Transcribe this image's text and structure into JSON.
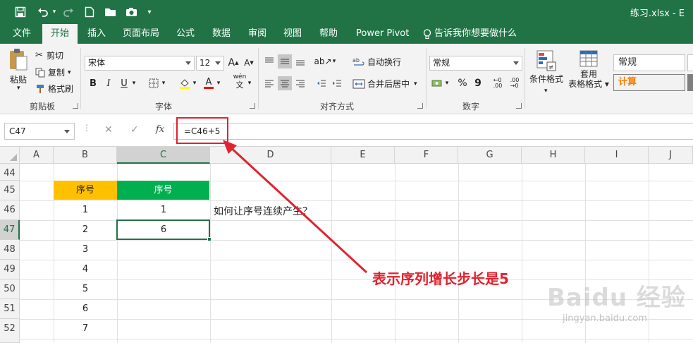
{
  "title_bar": {
    "filename": "练习.xlsx  -  E",
    "icons": [
      "save-icon",
      "undo-icon",
      "redo-icon",
      "new-file-icon",
      "open-folder-icon",
      "camera-icon",
      "customize-qat-icon"
    ]
  },
  "tabs": [
    "文件",
    "开始",
    "插入",
    "页面布局",
    "公式",
    "数据",
    "审阅",
    "视图",
    "帮助",
    "Power Pivot",
    "告诉我你想要做什么"
  ],
  "ribbon": {
    "clipboard": {
      "paste": "粘贴",
      "cut": "剪切",
      "copy": "复制",
      "format_painter": "格式刷",
      "label": "剪贴板"
    },
    "font": {
      "font_name": "宋体",
      "font_size": "12",
      "grow": "A",
      "shrink": "A",
      "bold": "B",
      "italic": "I",
      "underline": "U",
      "font_color_letter": "A",
      "phonetic": "wén",
      "label": "字体",
      "fill_color": "#ffff00",
      "text_color": "#ff0000"
    },
    "alignment": {
      "wrap_text": "自动换行",
      "merge_center": "合并后居中",
      "label": "对齐方式"
    },
    "number": {
      "format": "常规",
      "percent": "%",
      "comma": "9",
      "label": "数字"
    },
    "styles": {
      "conditional_format": "条件格式",
      "format_table_1": "套用",
      "format_table_2": "表格格式",
      "style_normal": "常规",
      "style_calc": "计算"
    }
  },
  "formula_bar": {
    "name_box": "C47",
    "cancel": "✕",
    "enter": "✓",
    "fx": "fx",
    "formula": "=C46+5"
  },
  "columns": [
    "A",
    "B",
    "C",
    "D",
    "E",
    "F",
    "G",
    "H",
    "I",
    "J"
  ],
  "rows": [
    "44",
    "45",
    "46",
    "47",
    "48",
    "49",
    "50",
    "51",
    "52"
  ],
  "table": {
    "header_b": "序号",
    "header_c": "序号",
    "col_b": [
      "1",
      "2",
      "3",
      "4",
      "5",
      "6",
      "7"
    ],
    "col_c": [
      "1",
      "6"
    ]
  },
  "question": "如何让序号连续产生？",
  "annotation": "表示序列增长步长是5",
  "watermark": {
    "logo": "Baidu 经验",
    "url": "jingyan.baidu.com"
  },
  "colors": {
    "excel_green": "#217346",
    "header_orange": "#ffc000",
    "header_green": "#00b050",
    "annotation_red": "#e0232f"
  }
}
